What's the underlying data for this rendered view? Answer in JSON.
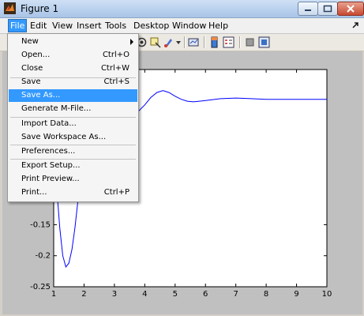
{
  "window": {
    "title": "Figure 1"
  },
  "menubar": {
    "items": [
      {
        "label": "File",
        "active": true
      },
      {
        "label": "Edit"
      },
      {
        "label": "View"
      },
      {
        "label": "Insert"
      },
      {
        "label": "Tools"
      },
      {
        "label": "Desktop"
      },
      {
        "label": "Window"
      },
      {
        "label": "Help"
      }
    ]
  },
  "file_menu": {
    "items": [
      {
        "label": "New",
        "shortcut": "",
        "submenu": true
      },
      {
        "label": "Open...",
        "shortcut": "Ctrl+O"
      },
      {
        "label": "Close",
        "shortcut": "Ctrl+W"
      },
      {
        "label": "Save",
        "shortcut": "Ctrl+S"
      },
      {
        "label": "Save As...",
        "shortcut": "",
        "highlighted": true
      },
      {
        "label": "Generate M-File...",
        "shortcut": ""
      },
      {
        "label": "Import Data...",
        "shortcut": ""
      },
      {
        "label": "Save Workspace As...",
        "shortcut": ""
      },
      {
        "label": "Preferences...",
        "shortcut": ""
      },
      {
        "label": "Export Setup...",
        "shortcut": ""
      },
      {
        "label": "Print Preview...",
        "shortcut": ""
      },
      {
        "label": "Print...",
        "shortcut": "Ctrl+P"
      }
    ]
  },
  "colors": {
    "line": "#0000ff",
    "menu_highlight": "#3399ff"
  },
  "chart_data": {
    "type": "line",
    "xlim": [
      1,
      10
    ],
    "ylim": [
      -0.25,
      0.1
    ],
    "x_ticks": [
      1,
      2,
      3,
      4,
      5,
      6,
      7,
      8,
      9,
      10
    ],
    "y_ticks_visible": [
      -0.15,
      -0.2,
      -0.25
    ],
    "y_tick_labels": [
      "-0.15",
      "-0.2",
      "-0.25"
    ],
    "grid": false,
    "series": [
      {
        "x": [
          1.0,
          1.1,
          1.2,
          1.3,
          1.4,
          1.5,
          1.6,
          1.7,
          1.8,
          1.9,
          2.0,
          2.2,
          2.4,
          2.6,
          2.8,
          3.0,
          3.2,
          3.4,
          3.6,
          3.8,
          4.0,
          4.2,
          4.4,
          4.6,
          4.8,
          5.0,
          5.2,
          5.4,
          5.6,
          5.8,
          6.0,
          6.5,
          7.0,
          7.5,
          8.0,
          8.5,
          9.0,
          9.5,
          10.0
        ],
        "values": [
          -0.02,
          -0.09,
          -0.155,
          -0.2,
          -0.218,
          -0.212,
          -0.19,
          -0.155,
          -0.11,
          -0.065,
          -0.025,
          0.02,
          0.04,
          0.045,
          0.04,
          0.03,
          0.022,
          0.02,
          0.025,
          0.033,
          0.043,
          0.055,
          0.063,
          0.066,
          0.063,
          0.057,
          0.052,
          0.049,
          0.048,
          0.049,
          0.05,
          0.053,
          0.054,
          0.053,
          0.052,
          0.052,
          0.052,
          0.052,
          0.052
        ]
      }
    ]
  }
}
